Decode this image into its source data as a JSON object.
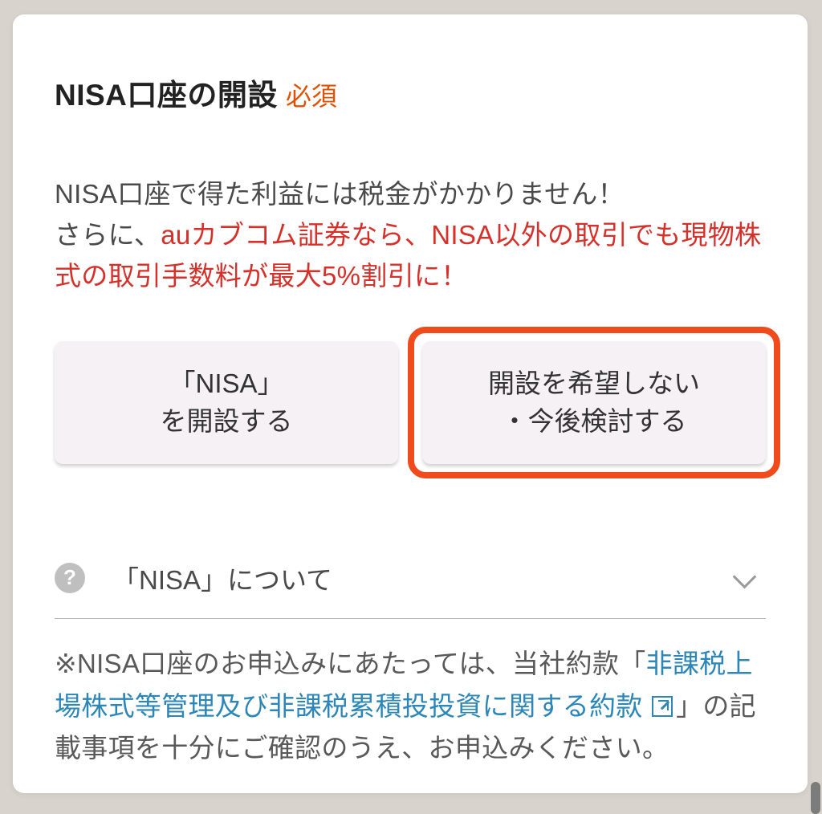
{
  "header": {
    "title": "NISA口座の開設",
    "required_badge": "必須"
  },
  "description": {
    "line1": "NISA口座で得た利益には税金がかかりません！",
    "highlight_prefix": "さらに、",
    "highlight_text": "auカブコム証券なら、NISA以外の取引でも現物株式の取引手数料が最大5%割引に！"
  },
  "options": {
    "open": {
      "line1": "「NISA」",
      "line2": "を開設する"
    },
    "decline": {
      "line1": "開設を希望しない",
      "line2": "・今後検討する"
    }
  },
  "accordion": {
    "title": "「NISA」について"
  },
  "note": {
    "prefix": "※NISA口座のお申込みにあたっては、当社約款「",
    "link_text": "非課税上場株式等管理及び非課税累積投投資に関する約款",
    "suffix": "」の記載事項を十分にご確認のうえ、お申込みください。"
  }
}
